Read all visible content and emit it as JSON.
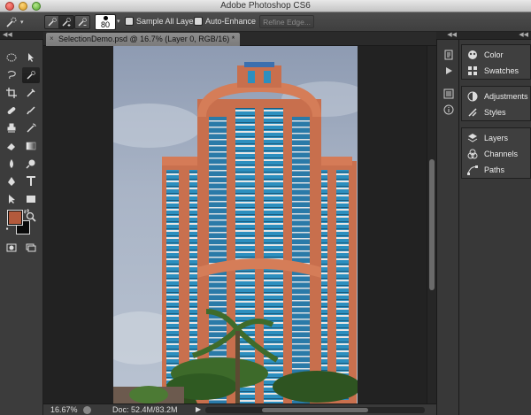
{
  "window": {
    "title": "Adobe Photoshop CS6"
  },
  "options_bar": {
    "brush_size": "80",
    "sample_all_layers": "Sample All Layers",
    "auto_enhance": "Auto-Enhance",
    "refine_edge": "Refine Edge..."
  },
  "document": {
    "tab_title": "SelectionDemo.psd @ 16.7% (Layer 0, RGB/16) *",
    "close_glyph": "×"
  },
  "status": {
    "zoom": "16.67%",
    "doc_size": "Doc: 52.4M/83.2M",
    "arrow": "▶"
  },
  "tools": {
    "foreground_color": "#b35a3c",
    "background_color": "#0a0a0a"
  },
  "panels": {
    "group1": [
      {
        "label": "Color",
        "icon": "color-icon"
      },
      {
        "label": "Swatches",
        "icon": "swatches-icon"
      }
    ],
    "group2": [
      {
        "label": "Adjustments",
        "icon": "adjustments-icon"
      },
      {
        "label": "Styles",
        "icon": "styles-icon"
      }
    ],
    "group3": [
      {
        "label": "Layers",
        "icon": "layers-icon"
      },
      {
        "label": "Channels",
        "icon": "channels-icon"
      },
      {
        "label": "Paths",
        "icon": "paths-icon"
      }
    ]
  },
  "collapse": {
    "left": "◀◀",
    "right": "▶▶"
  }
}
